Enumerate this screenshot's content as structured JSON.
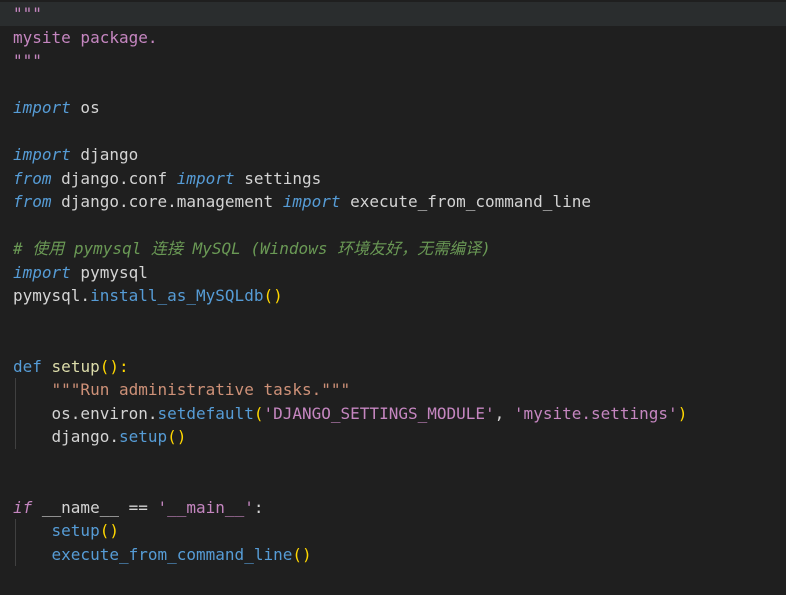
{
  "editor": {
    "lines": [
      {
        "tokens": [
          {
            "t": "\"\"\"",
            "c": "strm"
          }
        ]
      },
      {
        "tokens": [
          {
            "t": "mysite package.",
            "c": "strm"
          }
        ]
      },
      {
        "tokens": [
          {
            "t": "\"\"\"",
            "c": "strm"
          }
        ]
      },
      {
        "tokens": []
      },
      {
        "tokens": [
          {
            "t": "import",
            "c": "kw-i"
          },
          {
            "t": " os",
            "c": "id"
          }
        ]
      },
      {
        "tokens": []
      },
      {
        "tokens": [
          {
            "t": "import",
            "c": "kw-i"
          },
          {
            "t": " django",
            "c": "id"
          }
        ]
      },
      {
        "tokens": [
          {
            "t": "from",
            "c": "kw-i"
          },
          {
            "t": " django.conf ",
            "c": "id"
          },
          {
            "t": "import",
            "c": "kw-i"
          },
          {
            "t": " settings",
            "c": "id"
          }
        ]
      },
      {
        "tokens": [
          {
            "t": "from",
            "c": "kw-i"
          },
          {
            "t": " django.core.management ",
            "c": "id"
          },
          {
            "t": "import",
            "c": "kw-i"
          },
          {
            "t": " execute_from_command_line",
            "c": "id"
          }
        ]
      },
      {
        "tokens": []
      },
      {
        "tokens": [
          {
            "t": "# 使用 pymysql 连接 MySQL (Windows 环境友好，无需编译)",
            "c": "comment"
          }
        ]
      },
      {
        "tokens": [
          {
            "t": "import",
            "c": "kw-i"
          },
          {
            "t": " pymysql",
            "c": "id"
          }
        ]
      },
      {
        "tokens": [
          {
            "t": "pymysql.",
            "c": "id"
          },
          {
            "t": "install_as_MySQLdb",
            "c": "fn2"
          },
          {
            "t": "()",
            "c": "paren"
          }
        ]
      },
      {
        "tokens": []
      },
      {
        "tokens": []
      },
      {
        "tokens": [
          {
            "t": "def",
            "c": "fn2"
          },
          {
            "t": " ",
            "c": "id"
          },
          {
            "t": "setup",
            "c": "fn"
          },
          {
            "t": "():",
            "c": "paren"
          }
        ]
      },
      {
        "indent": true,
        "tokens": [
          {
            "t": "    ",
            "c": "id"
          },
          {
            "t": "\"\"\"Run administrative tasks.\"\"\"",
            "c": "doc"
          }
        ]
      },
      {
        "indent": true,
        "tokens": [
          {
            "t": "    os.environ.",
            "c": "id"
          },
          {
            "t": "setdefault",
            "c": "fn2"
          },
          {
            "t": "(",
            "c": "paren"
          },
          {
            "t": "'DJANGO_SETTINGS_MODULE'",
            "c": "strm"
          },
          {
            "t": ", ",
            "c": "id"
          },
          {
            "t": "'mysite.settings'",
            "c": "strm"
          },
          {
            "t": ")",
            "c": "paren"
          }
        ]
      },
      {
        "indent": true,
        "tokens": [
          {
            "t": "    django.",
            "c": "id"
          },
          {
            "t": "setup",
            "c": "fn2"
          },
          {
            "t": "()",
            "c": "paren"
          }
        ]
      },
      {
        "tokens": []
      },
      {
        "tokens": []
      },
      {
        "tokens": [
          {
            "t": "if",
            "c": "ctrl-i"
          },
          {
            "t": " __name__ == ",
            "c": "id"
          },
          {
            "t": "'__main__'",
            "c": "strm"
          },
          {
            "t": ":",
            "c": "id"
          }
        ]
      },
      {
        "indent": true,
        "tokens": [
          {
            "t": "    ",
            "c": "id"
          },
          {
            "t": "setup",
            "c": "fn2"
          },
          {
            "t": "()",
            "c": "paren"
          }
        ]
      },
      {
        "indent": true,
        "tokens": [
          {
            "t": "    ",
            "c": "id"
          },
          {
            "t": "execute_from_command_line",
            "c": "fn2"
          },
          {
            "t": "()",
            "c": "paren"
          }
        ]
      }
    ]
  }
}
